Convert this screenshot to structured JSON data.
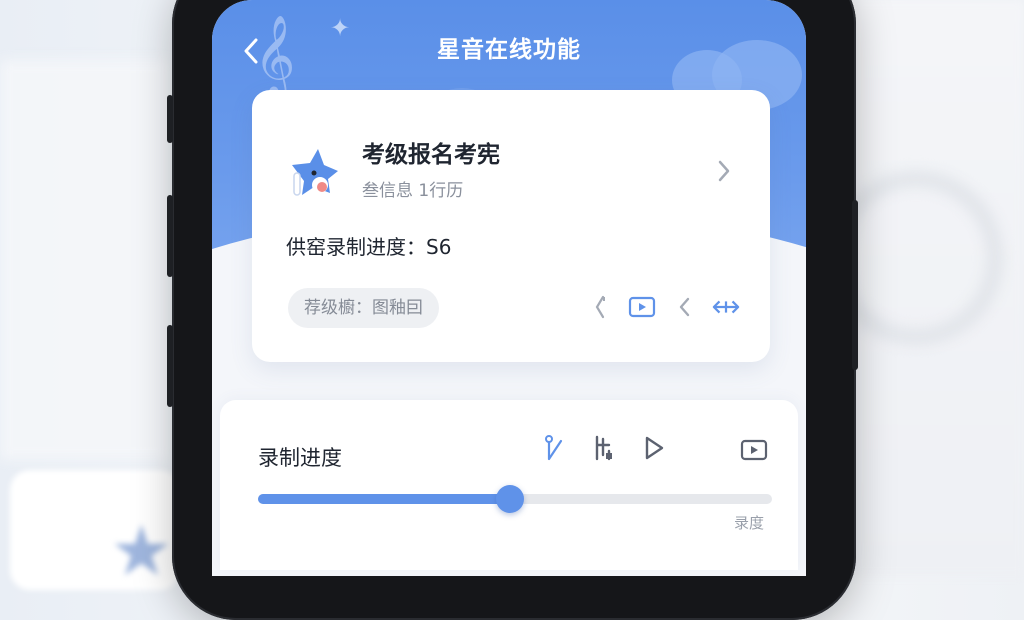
{
  "header": {
    "title": "星音在线功能"
  },
  "exam_card": {
    "title": "考级报名考宪",
    "subtitle": "叁信息 1行历",
    "progress_text": "供窑录制进度：S6",
    "level_pill": "荐级櫥：图釉囙",
    "icons": [
      "bracket-icon",
      "play-box-icon",
      "chevron-left-icon",
      "arrows-expand-icon"
    ]
  },
  "recording": {
    "title": "录制进度",
    "progress": 0.49,
    "caption": "录度",
    "icons": [
      "tuning-fork-icon",
      "metronome-icon",
      "play-icon",
      "video-icon"
    ]
  },
  "colors": {
    "accent": "#5f92e9",
    "hero_top": "#5a8fe8",
    "text_primary": "#1f2530",
    "text_secondary": "#8a909c"
  }
}
